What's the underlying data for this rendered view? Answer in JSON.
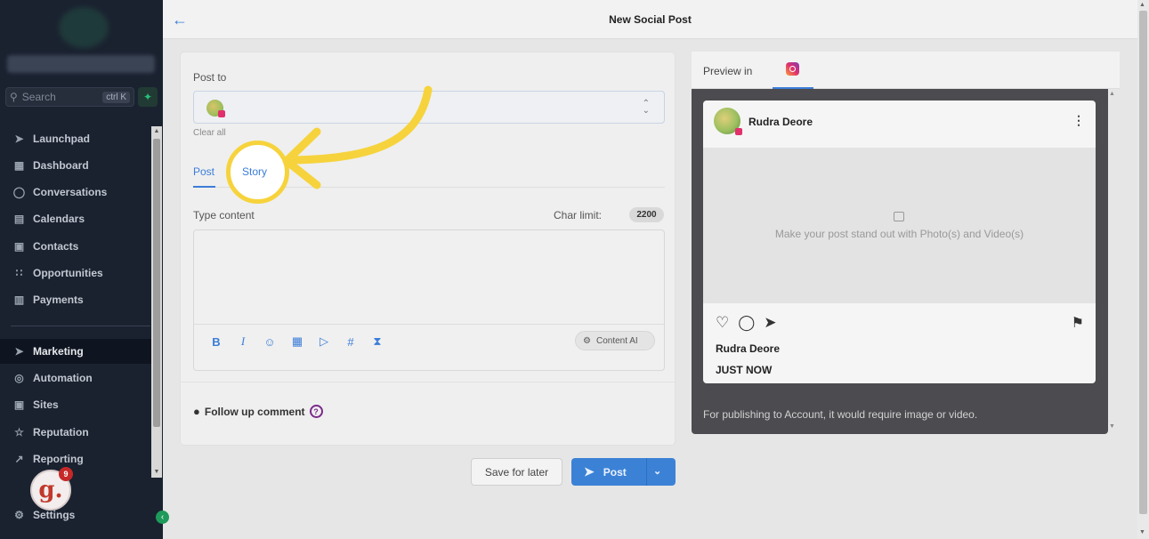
{
  "sidebar": {
    "search": {
      "placeholder": "Search",
      "shortcut": "ctrl K"
    },
    "items": [
      {
        "label": "Launchpad",
        "icon": "rocket-icon"
      },
      {
        "label": "Dashboard",
        "icon": "grid-icon"
      },
      {
        "label": "Conversations",
        "icon": "chat-icon"
      },
      {
        "label": "Calendars",
        "icon": "calendar-icon"
      },
      {
        "label": "Contacts",
        "icon": "contacts-icon"
      },
      {
        "label": "Opportunities",
        "icon": "opportunities-icon"
      },
      {
        "label": "Payments",
        "icon": "receipt-icon"
      },
      {
        "label": "Marketing",
        "icon": "send-icon",
        "active": true
      },
      {
        "label": "Automation",
        "icon": "automation-icon"
      },
      {
        "label": "Sites",
        "icon": "sites-icon"
      },
      {
        "label": "Reputation",
        "icon": "star-icon"
      },
      {
        "label": "Reporting",
        "icon": "trend-icon"
      },
      {
        "label": "Settings",
        "icon": "gear-icon"
      }
    ],
    "notification_count": "9",
    "avatar_letter": "g."
  },
  "header": {
    "title": "New Social Post"
  },
  "composer": {
    "post_to_label": "Post to",
    "clear_all": "Clear all",
    "tabs": [
      {
        "label": "Post"
      },
      {
        "label": "Story"
      }
    ],
    "type_content_label": "Type content",
    "char_limit_label": "Char limit:",
    "char_limit_value": "2200",
    "content_ai_label": "Content AI",
    "follow_up_label": "Follow up comment",
    "help_glyph": "?"
  },
  "actions": {
    "save_label": "Save for later",
    "post_label": "Post"
  },
  "preview": {
    "label": "Preview in",
    "account_name": "Rudra Deore",
    "media_placeholder": "Make your post stand out with Photo(s) and Video(s)",
    "username": "Rudra Deore",
    "timestamp": "JUST NOW",
    "note": "For publishing to Account, it would require image or video."
  },
  "colors": {
    "accent": "#3b7dd8",
    "highlight": "#f6d33c",
    "sidebar_bg": "#1a2230",
    "instagram": "#e1306c"
  }
}
